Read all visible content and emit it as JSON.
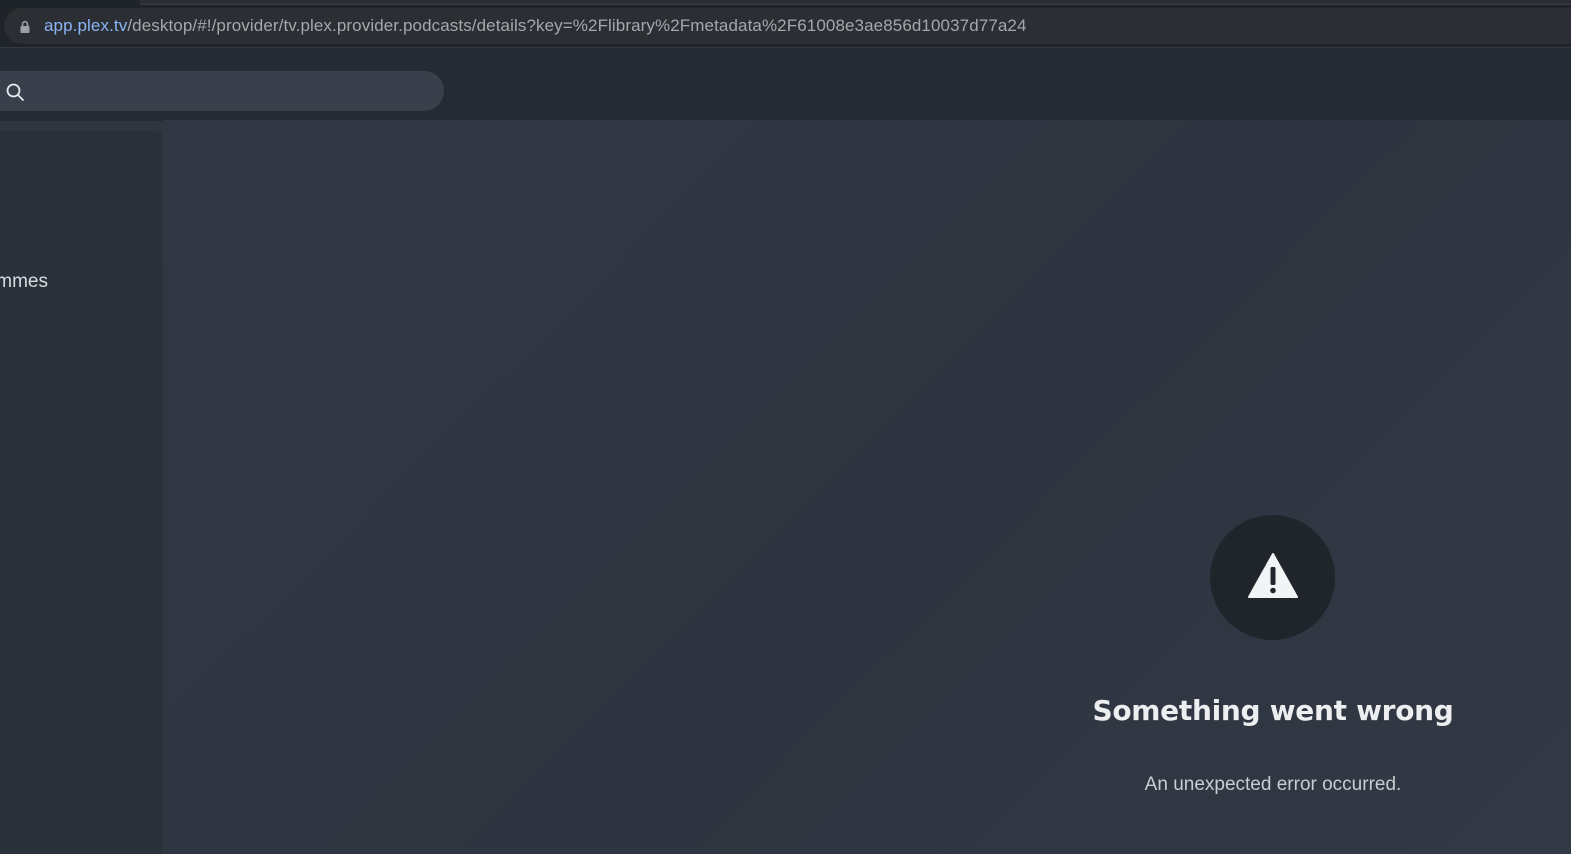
{
  "browser": {
    "url_host": "app.plex.tv",
    "url_path": "/desktop/#!/provider/tv.plex.provider.podcasts/details?key=%2Flibrary%2Fmetadata%2F61008e3ae856d10037d77a24"
  },
  "header": {
    "search_icon": "search-icon",
    "search_placeholder": ""
  },
  "sidebar": {
    "items": [
      {
        "label": "mmes"
      }
    ]
  },
  "main": {
    "error": {
      "icon": "warning-icon",
      "title": "Something went wrong",
      "message": "An unexpected error occurred."
    }
  },
  "colors": {
    "accent_url": "#8ab4f8",
    "background": "#303641",
    "error_circle": "#20252c"
  }
}
